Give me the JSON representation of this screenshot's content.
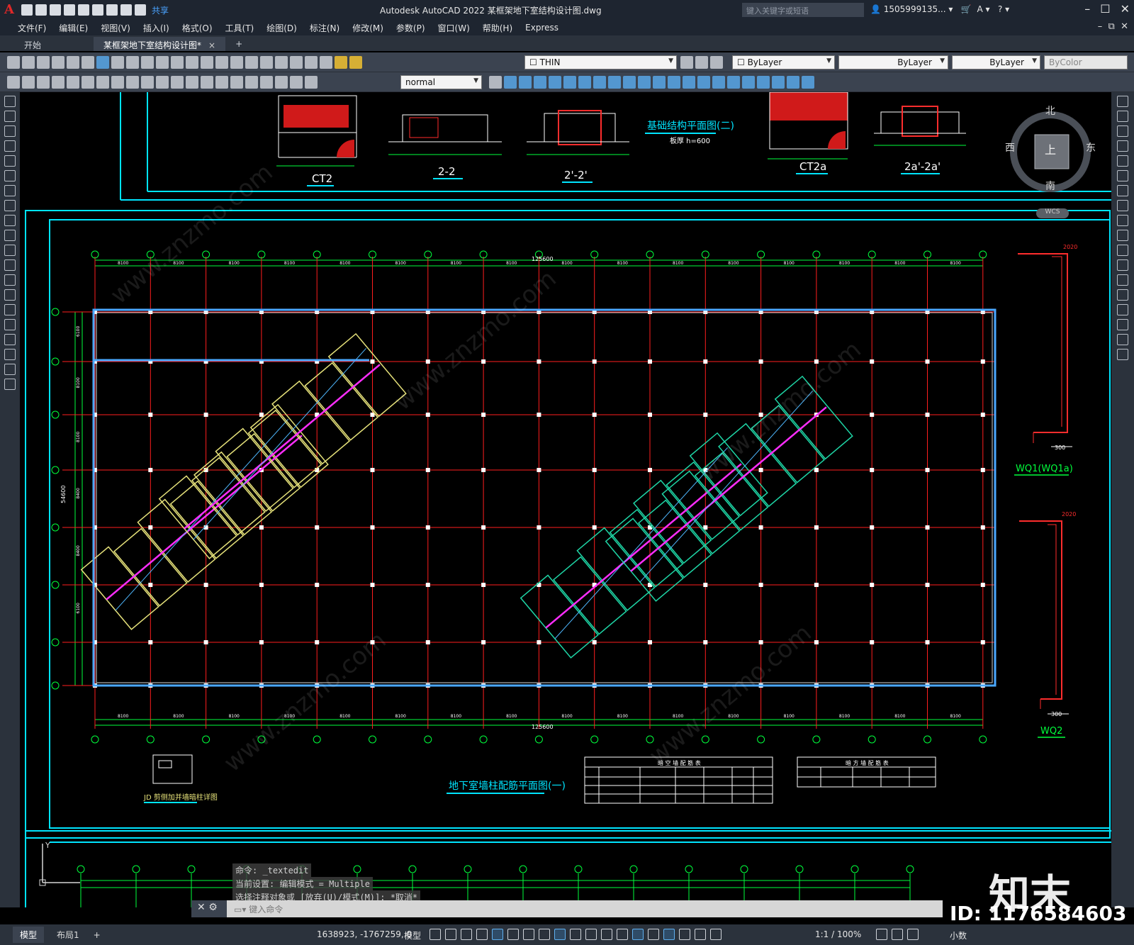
{
  "app": {
    "title": "Autodesk AutoCAD 2022    某框架地下室结构设计图.dwg",
    "share_label": "共享",
    "search_placeholder": "键入关键字或短语",
    "user": "1505999135...",
    "logo_letter": "A"
  },
  "menu": [
    "文件(F)",
    "编辑(E)",
    "视图(V)",
    "插入(I)",
    "格式(O)",
    "工具(T)",
    "绘图(D)",
    "标注(N)",
    "修改(M)",
    "参数(P)",
    "窗口(W)",
    "帮助(H)",
    "Express"
  ],
  "tabs": {
    "start": "开始",
    "doc": "某框架地下室结构设计图*",
    "close": "×",
    "add": "+"
  },
  "toolbar": {
    "layer_name": "THIN",
    "color": "ByLayer",
    "linetype": "ByLayer",
    "lineweight": "ByLayer",
    "plotstyle": "ByColor",
    "textstyle": "normal"
  },
  "viewcube": {
    "north": "北",
    "south": "南",
    "west": "西",
    "east": "东",
    "face": "上",
    "wcs": "WCS"
  },
  "drawing": {
    "section_labels": [
      "CT2",
      "2-2",
      "2'-2'",
      "CT2a",
      "2a'-2a'"
    ],
    "plan_title_2": "基础结构平面图(二)",
    "plan_note_2": "板厚 h=600",
    "main_title": "地下室墙柱配筋平面图(一)",
    "detail_title": "JD 剪侧加并墙暗柱详图",
    "wall_labels": [
      "WQ1(WQ1a)",
      "WQ2"
    ],
    "total_dim": "125600",
    "bay_dims": [
      "8100",
      "8100",
      "8100",
      "8100",
      "8100",
      "8100",
      "8100",
      "8100",
      "8100",
      "8100",
      "8100",
      "8100",
      "8100",
      "8100",
      "8100",
      "8100"
    ],
    "side_dims": [
      "6100",
      "8100",
      "8100",
      "8400",
      "8400",
      "6100"
    ],
    "side_total": "54600",
    "wall_dims": [
      "2020",
      "300"
    ],
    "table1_title": "暗 空 墙 配 筋 表",
    "table2_title": "暗 方 墙 配 筋 表"
  },
  "command": {
    "history": [
      "命令: _textedit",
      "当前设置: 编辑模式 = Multiple",
      "选择注释对象或 [放弃(U)/模式(M)]: *取消*"
    ],
    "input_placeholder": "键入命令"
  },
  "status": {
    "layout_tabs": [
      "模型",
      "布局1"
    ],
    "add": "+",
    "coords": "1638923, -1767259, 0",
    "model_label": "模型",
    "scale": "1:1 / 100%",
    "units": "小数"
  },
  "watermark": {
    "brand": "知末",
    "id": "ID: 1176584603",
    "site": "www.znzmo.com"
  },
  "colors": {
    "grid": "#ff1e1e",
    "dim": "#00ff3c",
    "frame": "#00e5ff",
    "wall": "#4aa8ff",
    "building_a": "#e6e27a",
    "building_b": "#1ed6a6",
    "magenta": "#ff2dff",
    "bg": "#000000"
  }
}
